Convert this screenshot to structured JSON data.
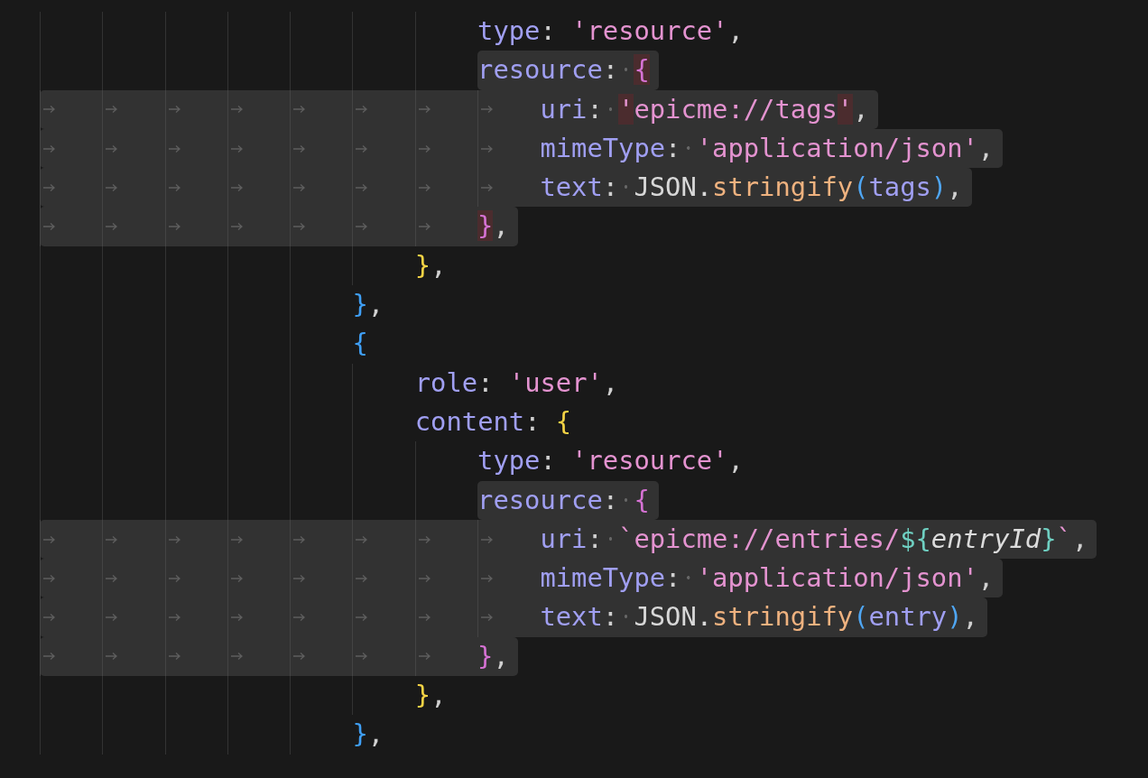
{
  "editor": {
    "lines": [
      {
        "children": [
          {
            "children": [
              {
                "children": [
                  {
                    "selected": false,
                    "tokens": [
                      {
                        "text": "type",
                        "kind": "property"
                      },
                      {
                        "text": ": ",
                        "kind": "punctuation"
                      },
                      {
                        "text": "'resource'",
                        "kind": "string"
                      },
                      {
                        "text": ",",
                        "kind": "punctuation"
                      }
                    ]
                  },
                  {
                    "selected": true,
                    "whole_line": false,
                    "tokens": [
                      {
                        "text": "resource",
                        "kind": "property"
                      },
                      {
                        "text": ": ",
                        "kind": "punctuation"
                      },
                      {
                        "text": "{",
                        "kind": "brace_pink",
                        "match": true
                      }
                    ],
                    "children": [
                      {
                        "selected": true,
                        "whole_line": true,
                        "tokens": [
                          {
                            "text": "uri",
                            "kind": "property"
                          },
                          {
                            "text": ": ",
                            "kind": "punctuation"
                          },
                          {
                            "text": "'",
                            "kind": "string",
                            "match": true
                          },
                          {
                            "text": "epicme://tags",
                            "kind": "string"
                          },
                          {
                            "text": "'",
                            "kind": "string",
                            "match": true
                          },
                          {
                            "text": ",",
                            "kind": "punctuation"
                          }
                        ]
                      },
                      {
                        "selected": true,
                        "whole_line": true,
                        "tokens": [
                          {
                            "text": "mimeType",
                            "kind": "property"
                          },
                          {
                            "text": ": ",
                            "kind": "punctuation"
                          },
                          {
                            "text": "'application/json'",
                            "kind": "string"
                          },
                          {
                            "text": ",",
                            "kind": "punctuation"
                          }
                        ]
                      },
                      {
                        "selected": true,
                        "whole_line": true,
                        "tokens": [
                          {
                            "text": "text",
                            "kind": "property"
                          },
                          {
                            "text": ": ",
                            "kind": "punctuation"
                          },
                          {
                            "text": "JSON.",
                            "kind": "identifier"
                          },
                          {
                            "text": "stringify",
                            "kind": "function"
                          },
                          {
                            "text": "(",
                            "kind": "paren"
                          },
                          {
                            "text": "tags",
                            "kind": "variable"
                          },
                          {
                            "text": ")",
                            "kind": "paren"
                          },
                          {
                            "text": ",",
                            "kind": "punctuation"
                          }
                        ]
                      }
                    ]
                  },
                  {
                    "selected": true,
                    "whole_line": true,
                    "tokens": [
                      {
                        "text": "}",
                        "kind": "brace_pink",
                        "match": true
                      },
                      {
                        "text": ",",
                        "kind": "punctuation"
                      }
                    ]
                  }
                ]
              },
              {
                "selected": false,
                "tokens": [
                  {
                    "text": "}",
                    "kind": "brace_yellow"
                  },
                  {
                    "text": ",",
                    "kind": "punctuation"
                  }
                ]
              }
            ]
          },
          {
            "selected": false,
            "tokens": [
              {
                "text": "}",
                "kind": "brace_blue"
              },
              {
                "text": ",",
                "kind": "punctuation"
              }
            ]
          },
          {
            "selected": false,
            "tokens": [
              {
                "text": "{",
                "kind": "brace_blue"
              }
            ],
            "children": [
              {
                "selected": false,
                "tokens": [
                  {
                    "text": "role",
                    "kind": "property"
                  },
                  {
                    "text": ": ",
                    "kind": "punctuation"
                  },
                  {
                    "text": "'user'",
                    "kind": "string"
                  },
                  {
                    "text": ",",
                    "kind": "punctuation"
                  }
                ]
              },
              {
                "selected": false,
                "tokens": [
                  {
                    "text": "content",
                    "kind": "property"
                  },
                  {
                    "text": ": ",
                    "kind": "punctuation"
                  },
                  {
                    "text": "{",
                    "kind": "brace_yellow"
                  }
                ],
                "children": [
                  {
                    "selected": false,
                    "tokens": [
                      {
                        "text": "type",
                        "kind": "property"
                      },
                      {
                        "text": ": ",
                        "kind": "punctuation"
                      },
                      {
                        "text": "'resource'",
                        "kind": "string"
                      },
                      {
                        "text": ",",
                        "kind": "punctuation"
                      }
                    ]
                  },
                  {
                    "selected": true,
                    "whole_line": false,
                    "tokens": [
                      {
                        "text": "resource",
                        "kind": "property"
                      },
                      {
                        "text": ": ",
                        "kind": "punctuation"
                      },
                      {
                        "text": "{",
                        "kind": "brace_pink"
                      }
                    ],
                    "children": [
                      {
                        "selected": true,
                        "whole_line": true,
                        "tokens": [
                          {
                            "text": "uri",
                            "kind": "property"
                          },
                          {
                            "text": ": ",
                            "kind": "punctuation"
                          },
                          {
                            "text": "`epicme://entries/",
                            "kind": "string"
                          },
                          {
                            "text": "${",
                            "kind": "template"
                          },
                          {
                            "text": "entryId",
                            "kind": "template_var"
                          },
                          {
                            "text": "}",
                            "kind": "template"
                          },
                          {
                            "text": "`",
                            "kind": "string"
                          },
                          {
                            "text": ",",
                            "kind": "punctuation"
                          }
                        ]
                      },
                      {
                        "selected": true,
                        "whole_line": true,
                        "tokens": [
                          {
                            "text": "mimeType",
                            "kind": "property"
                          },
                          {
                            "text": ": ",
                            "kind": "punctuation"
                          },
                          {
                            "text": "'application/json'",
                            "kind": "string"
                          },
                          {
                            "text": ",",
                            "kind": "punctuation"
                          }
                        ]
                      },
                      {
                        "selected": true,
                        "whole_line": true,
                        "tokens": [
                          {
                            "text": "text",
                            "kind": "property"
                          },
                          {
                            "text": ": ",
                            "kind": "punctuation"
                          },
                          {
                            "text": "JSON.",
                            "kind": "identifier"
                          },
                          {
                            "text": "stringify",
                            "kind": "function"
                          },
                          {
                            "text": "(",
                            "kind": "paren"
                          },
                          {
                            "text": "entry",
                            "kind": "variable"
                          },
                          {
                            "text": ")",
                            "kind": "paren"
                          },
                          {
                            "text": ",",
                            "kind": "punctuation"
                          }
                        ]
                      }
                    ]
                  },
                  {
                    "selected": true,
                    "whole_line": true,
                    "tokens": [
                      {
                        "text": "}",
                        "kind": "brace_pink"
                      },
                      {
                        "text": ",",
                        "kind": "punctuation"
                      }
                    ]
                  }
                ]
              },
              {
                "selected": false,
                "tokens": [
                  {
                    "text": "}",
                    "kind": "brace_yellow"
                  },
                  {
                    "text": ",",
                    "kind": "punctuation"
                  }
                ]
              }
            ]
          },
          {
            "selected": false,
            "tokens": [
              {
                "text": "}",
                "kind": "brace_blue"
              },
              {
                "text": ",",
                "kind": "punctuation"
              }
            ]
          }
        ]
      }
    ]
  }
}
